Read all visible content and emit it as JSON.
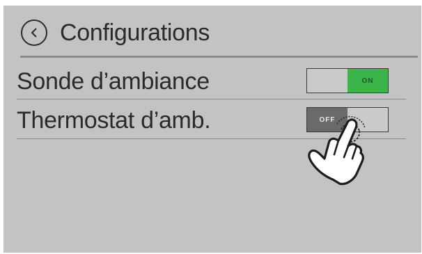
{
  "header": {
    "title": "Configurations",
    "back_icon": "chevron-left-circle-icon"
  },
  "settings": [
    {
      "label": "Sonde d’ambiance",
      "state": "on",
      "toggle_text": "ON"
    },
    {
      "label": "Thermostat d’amb.",
      "state": "off",
      "toggle_text": "OFF"
    }
  ],
  "overlay": {
    "icon": "tap-hand-icon"
  },
  "colors": {
    "background": "#c2c3c5",
    "on": "#3ab54a",
    "off": "#6a6a6c",
    "text": "#2a2a2a"
  }
}
